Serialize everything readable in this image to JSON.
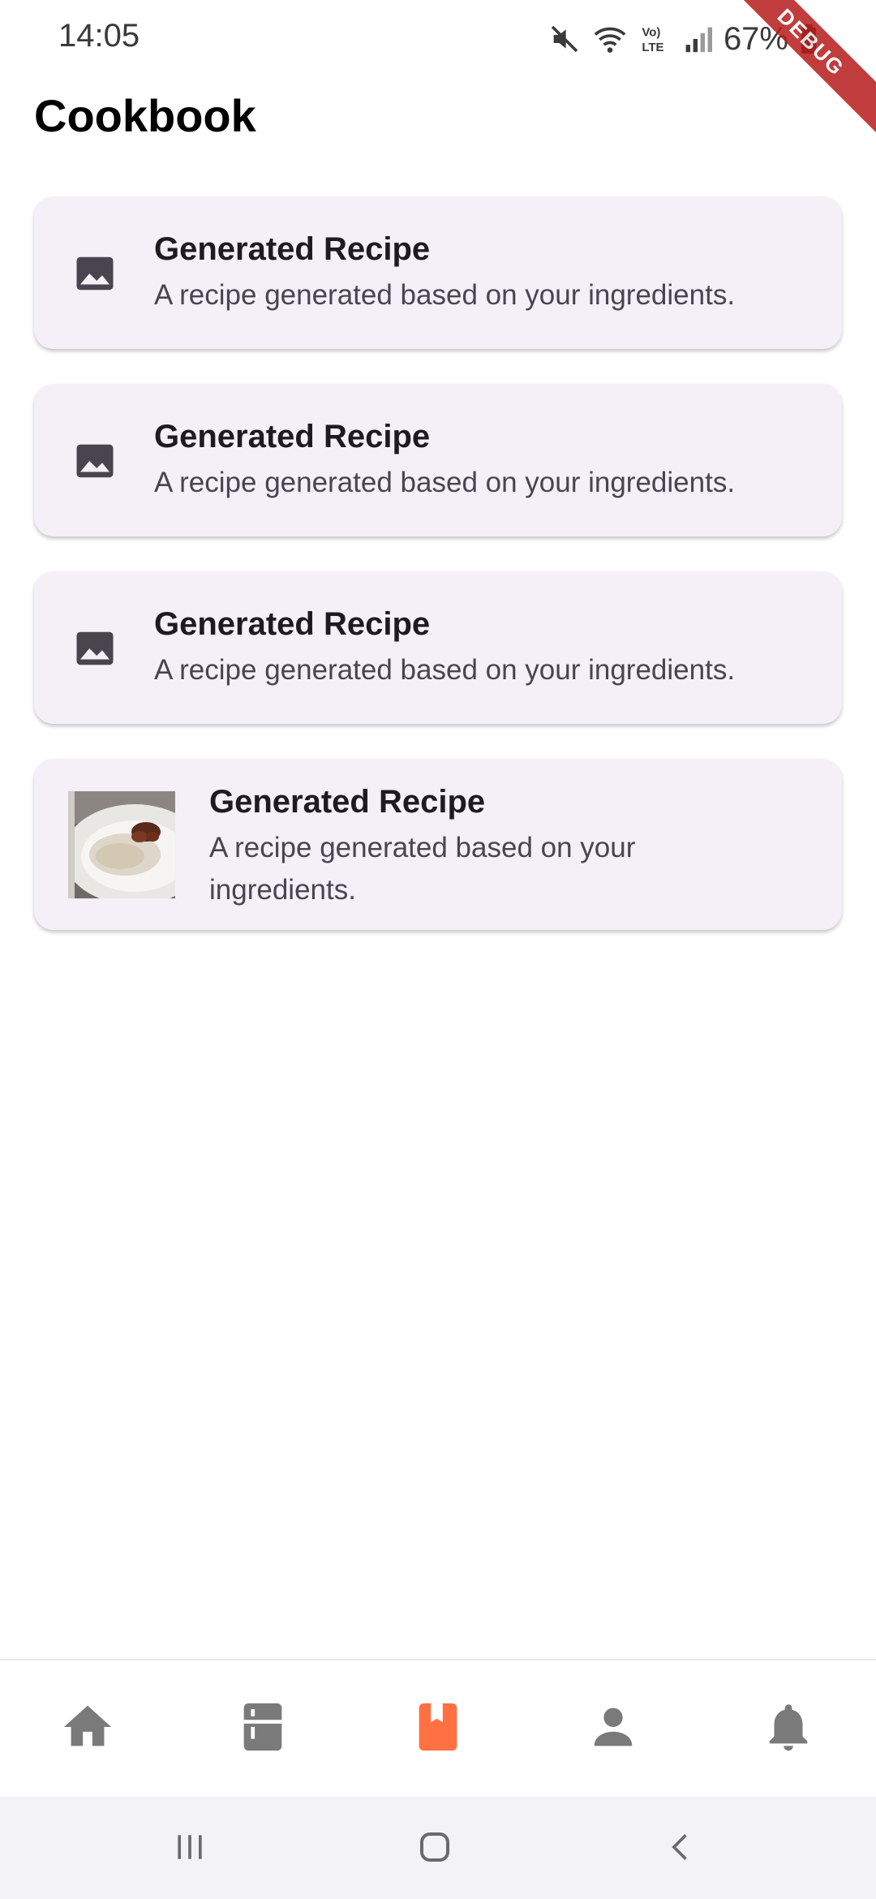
{
  "status_bar": {
    "time": "14:05",
    "battery_percent": "67%",
    "icons": [
      "mute-icon",
      "wifi-icon",
      "volte-icon",
      "signal-icon",
      "battery-icon"
    ],
    "debug_banner": "DEBUG"
  },
  "page": {
    "title": "Cookbook"
  },
  "recipes": [
    {
      "title": "Generated Recipe",
      "description": "A recipe generated based on your ingredients.",
      "thumbnail": "image-placeholder-icon"
    },
    {
      "title": "Generated Recipe",
      "description": "A recipe generated based on your ingredients.",
      "thumbnail": "image-placeholder-icon"
    },
    {
      "title": "Generated Recipe",
      "description": "A recipe generated based on your ingredients.",
      "thumbnail": "image-placeholder-icon"
    },
    {
      "title": "Generated Recipe",
      "description": "A recipe generated based on your ingredients.",
      "thumbnail": "recipe-photo"
    }
  ],
  "bottom_nav": {
    "items": [
      "home-icon",
      "fridge-icon",
      "cookbook-icon",
      "profile-icon",
      "notifications-icon"
    ],
    "active": "cookbook-icon",
    "active_color": "#ff7043",
    "inactive_color": "#7a7a7a"
  },
  "system_nav": {
    "buttons": [
      "recents-icon",
      "home-circle-icon",
      "back-icon"
    ]
  },
  "colors": {
    "card_background": "#f5eff7",
    "title_text": "#1d1b20",
    "description_text": "#49454f"
  }
}
